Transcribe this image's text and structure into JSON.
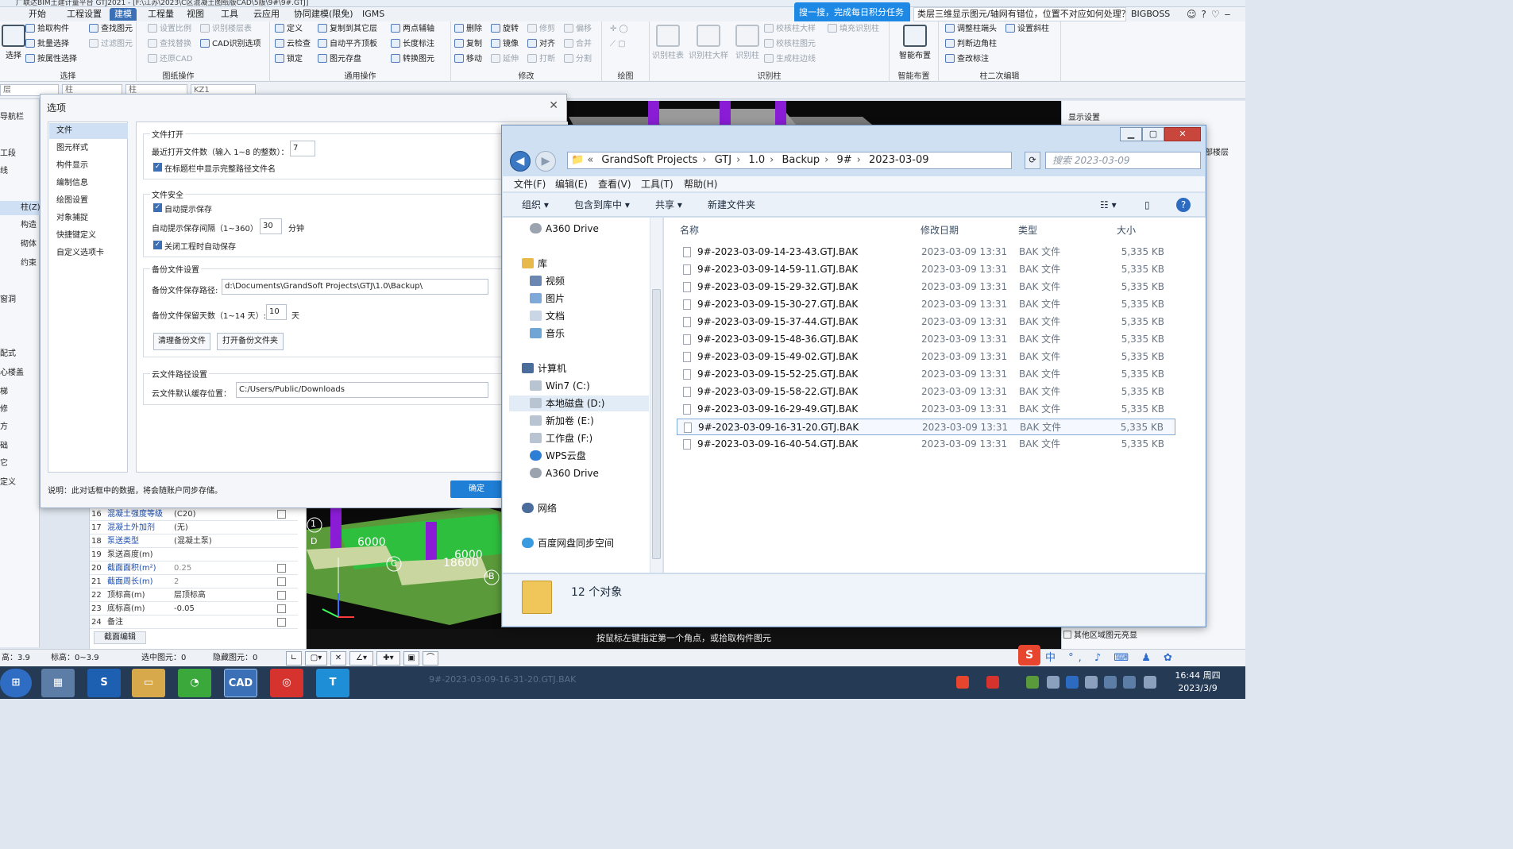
{
  "title_strip": "广联达BIM土建计量平台 GTJ2021 - [F:\\江苏\\2023\\C区混凝土图纸版CAD\\5版\\9#\\9#.GTJ]",
  "ribbon_tabs": [
    "开始",
    "工程设置",
    "建模",
    "工程量",
    "视图",
    "工具",
    "云应用",
    "协同建模(限免)",
    "IGMS"
  ],
  "help_bubble": "搜一搜，完成每日积分任务~",
  "quick_search": "类层三维显示图元/轴网有错位，位置不对应如何处理？",
  "user": "BIGBOSS",
  "ribbon": {
    "select": {
      "title": "选择",
      "big": "选择",
      "items": [
        "拾取构件",
        "批量选择",
        "按属性选择"
      ]
    },
    "cad": {
      "title": "图纸操作",
      "items": [
        "查找图元",
        "过滤图元",
        "设置比例",
        "查找替换",
        "还原CAD",
        "识别楼层表",
        "CAD识别选项"
      ]
    },
    "common": {
      "title": "通用操作",
      "items": [
        "定义",
        "云检查",
        "锁定",
        "复制到其它层",
        "自动平齐顶板",
        "图元存盘",
        "两点辅轴",
        "长度标注",
        "转换图元"
      ]
    },
    "modify": {
      "title": "修改",
      "items": [
        "删除",
        "复制",
        "移动",
        "旋转",
        "镜像",
        "延伸",
        "修剪",
        "对齐",
        "打断",
        "偏移",
        "合并",
        "分割"
      ]
    },
    "draw": {
      "title": "绘图"
    },
    "recognize": {
      "title": "识别柱",
      "items": [
        "识别柱表",
        "识别柱大样",
        "识别柱",
        "校核柱大样",
        "校核柱图元",
        "生成柱边线",
        "填充识别柱"
      ]
    },
    "smart": {
      "title": "智能布置",
      "big": "智能布置"
    },
    "edit2": {
      "title": "柱二次编辑",
      "items": [
        "调整柱端头",
        "判断边角柱",
        "查改标注",
        "设置斜柱"
      ]
    }
  },
  "subbar_combos": [
    "层",
    "柱",
    "柱",
    "KZ1"
  ],
  "left_nav": [
    "导航栏",
    "工段",
    "线",
    "柱(Z)",
    "构造",
    "砌体",
    "约束",
    "窗洞",
    "配式",
    "心楼盖",
    "梯",
    "修",
    "方",
    "础",
    "它",
    "定义"
  ],
  "options_dialog": {
    "title": "选项",
    "categories": [
      "文件",
      "图元样式",
      "构件显示",
      "编制信息",
      "绘图设置",
      "对象捕捉",
      "快捷键定义",
      "自定义选项卡"
    ],
    "file_open": {
      "title": "文件打开",
      "recent_label": "最近打开文件数（输入 1~8 的整数）：",
      "recent_value": "7",
      "show_full_path": "在标题栏中显示完整路径文件名"
    },
    "file_safety": {
      "title": "文件安全",
      "auto_save": "自动提示保存",
      "interval_label": "自动提示保存间隔（1~360）",
      "interval_value": "30",
      "interval_unit": "分钟",
      "save_on_close": "关闭工程时自动保存"
    },
    "backup": {
      "title": "备份文件设置",
      "path_label": "备份文件保存路径:",
      "path_value": "d:\\Documents\\GrandSoft Projects\\GTJ\\1.0\\Backup\\",
      "days_label": "备份文件保留天数（1~14 天）:",
      "days_value": "10",
      "days_unit": "天",
      "clear_btn": "清理备份文件",
      "open_btn": "打开备份文件夹"
    },
    "cloud": {
      "title": "云文件路径设置",
      "cache_label": "云文件默认缓存位置：",
      "cache_value": "C:/Users/Public/Downloads"
    },
    "note": "说明：此对话框中的数据，将会随账户同步存储。",
    "ok": "确定"
  },
  "explorer": {
    "address": [
      "GrandSoft Projects",
      "GTJ",
      "1.0",
      "Backup",
      "9#",
      "2023-03-09"
    ],
    "search_placeholder": "搜索 2023-03-09",
    "menu": [
      "文件(F)",
      "编辑(E)",
      "查看(V)",
      "工具(T)",
      "帮助(H)"
    ],
    "toolbar": [
      "组织 ▾",
      "包含到库中 ▾",
      "共享 ▾",
      "新建文件夹"
    ],
    "tree": [
      {
        "label": "A360 Drive",
        "indent": 0
      },
      {
        "label": "库",
        "indent": 0
      },
      {
        "label": "视频",
        "indent": 1
      },
      {
        "label": "图片",
        "indent": 1
      },
      {
        "label": "文档",
        "indent": 1
      },
      {
        "label": "音乐",
        "indent": 1
      },
      {
        "label": "计算机",
        "indent": 0
      },
      {
        "label": "Win7 (C:)",
        "indent": 1
      },
      {
        "label": "本地磁盘 (D:)",
        "indent": 1
      },
      {
        "label": "新加卷 (E:)",
        "indent": 1
      },
      {
        "label": "工作盘 (F:)",
        "indent": 1
      },
      {
        "label": "WPS云盘",
        "indent": 1
      },
      {
        "label": "A360 Drive",
        "indent": 1
      },
      {
        "label": "网络",
        "indent": 0
      },
      {
        "label": "百度网盘同步空间",
        "indent": 0
      }
    ],
    "columns": [
      "名称",
      "修改日期",
      "类型",
      "大小"
    ],
    "files": [
      {
        "name": "9#-2023-03-09-14-23-43.GTJ.BAK",
        "date": "2023-03-09 13:31",
        "type": "BAK 文件",
        "size": "5,335 KB"
      },
      {
        "name": "9#-2023-03-09-14-59-11.GTJ.BAK",
        "date": "2023-03-09 13:31",
        "type": "BAK 文件",
        "size": "5,335 KB"
      },
      {
        "name": "9#-2023-03-09-15-29-32.GTJ.BAK",
        "date": "2023-03-09 13:31",
        "type": "BAK 文件",
        "size": "5,335 KB"
      },
      {
        "name": "9#-2023-03-09-15-30-27.GTJ.BAK",
        "date": "2023-03-09 13:31",
        "type": "BAK 文件",
        "size": "5,335 KB"
      },
      {
        "name": "9#-2023-03-09-15-37-44.GTJ.BAK",
        "date": "2023-03-09 13:31",
        "type": "BAK 文件",
        "size": "5,335 KB"
      },
      {
        "name": "9#-2023-03-09-15-48-36.GTJ.BAK",
        "date": "2023-03-09 13:31",
        "type": "BAK 文件",
        "size": "5,335 KB"
      },
      {
        "name": "9#-2023-03-09-15-49-02.GTJ.BAK",
        "date": "2023-03-09 13:31",
        "type": "BAK 文件",
        "size": "5,335 KB"
      },
      {
        "name": "9#-2023-03-09-15-52-25.GTJ.BAK",
        "date": "2023-03-09 13:31",
        "type": "BAK 文件",
        "size": "5,335 KB"
      },
      {
        "name": "9#-2023-03-09-15-58-22.GTJ.BAK",
        "date": "2023-03-09 13:31",
        "type": "BAK 文件",
        "size": "5,335 KB"
      },
      {
        "name": "9#-2023-03-09-16-29-49.GTJ.BAK",
        "date": "2023-03-09 13:31",
        "type": "BAK 文件",
        "size": "5,335 KB"
      },
      {
        "name": "9#-2023-03-09-16-31-20.GTJ.BAK",
        "date": "2023-03-09 13:31",
        "type": "BAK 文件",
        "size": "5,335 KB",
        "selected": true
      },
      {
        "name": "9#-2023-03-09-16-40-54.GTJ.BAK",
        "date": "2023-03-09 13:31",
        "type": "BAK 文件",
        "size": "5,335 KB"
      }
    ],
    "status_count": "12 个对象"
  },
  "properties": [
    {
      "n": "16",
      "k": "混凝土强度等级",
      "v": "(C20)"
    },
    {
      "n": "17",
      "k": "混凝土外加剂",
      "v": "(无)"
    },
    {
      "n": "18",
      "k": "泵送类型",
      "v": "(混凝土泵)"
    },
    {
      "n": "19",
      "k": "泵送高度(m)",
      "v": ""
    },
    {
      "n": "20",
      "k": "截面面积(m²)",
      "v": "0.25"
    },
    {
      "n": "21",
      "k": "截面周长(m)",
      "v": "2"
    },
    {
      "n": "22",
      "k": "顶标高(m)",
      "v": "层顶标高"
    },
    {
      "n": "23",
      "k": "底标高(m)",
      "v": "-0.05"
    },
    {
      "n": "24",
      "k": "备注",
      "v": ""
    }
  ],
  "props_button": "截面编辑",
  "viewport_labels": [
    "6000",
    "6000",
    "18600",
    "1",
    "D",
    "C",
    "B"
  ],
  "viewport_hint": "按鼠标左键指定第一个角点，或拾取构件图元",
  "right_panel": {
    "title": "显示设置",
    "item": "部楼层",
    "other_check": "其他区域图元亮显"
  },
  "status_bar": {
    "height": "高：3.9",
    "elevation": "标高：0~3.9",
    "selected": "选中图元：0",
    "hidden": "隐藏图元：0"
  },
  "taskbar_ghost": "9#-2023-03-09-16-31-20.GTJ.BAK",
  "clock": {
    "time": "16:44 周四",
    "date": "2023/3/9"
  },
  "colors": {
    "accent": "#3b6fb6",
    "ok": "#1f7fd6",
    "taskbar": "#243a55"
  }
}
